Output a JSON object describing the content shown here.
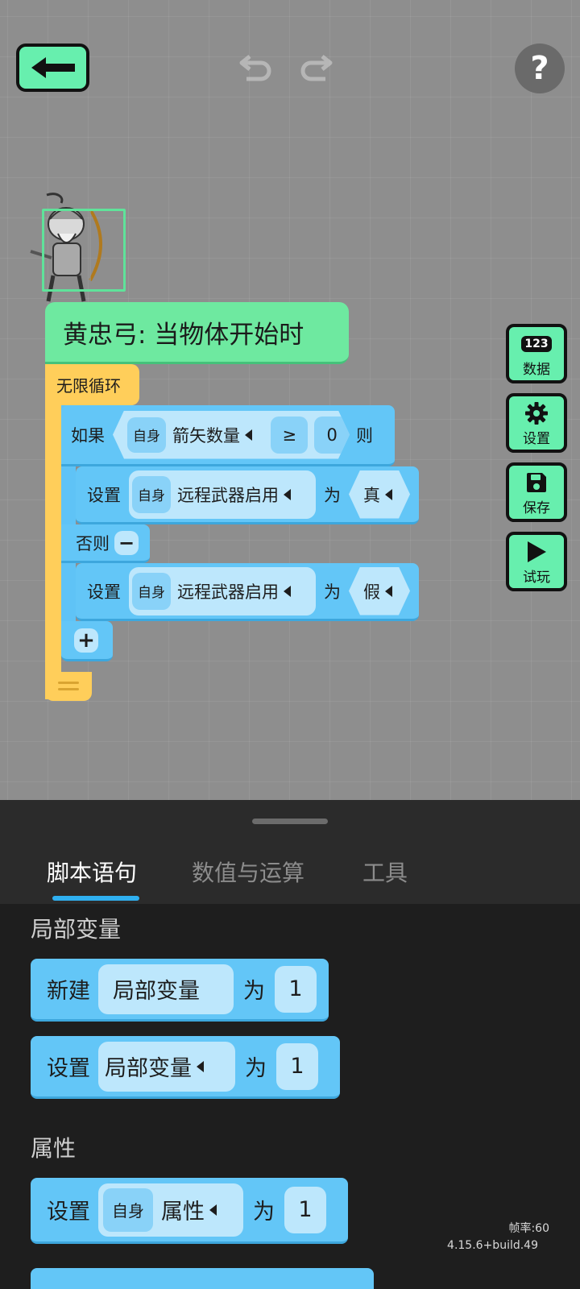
{
  "toolbar": {
    "help_label": "?"
  },
  "hat": {
    "label": "黄忠弓: 当物体开始时"
  },
  "loop": {
    "label": "无限循环"
  },
  "if_block": {
    "if_label": "如果",
    "target": "自身",
    "variable": "箭矢数量",
    "operator": "≥",
    "value": "0",
    "then_label": "则"
  },
  "set_true": {
    "set_label": "设置",
    "target": "自身",
    "property": "远程武器启用",
    "to_label": "为",
    "value": "真"
  },
  "else_block": {
    "label": "否则",
    "minus": "−"
  },
  "set_false": {
    "set_label": "设置",
    "target": "自身",
    "property": "远程武器启用",
    "to_label": "为",
    "value": "假"
  },
  "add_branch": "+",
  "side_buttons": [
    {
      "icon_text": "123",
      "label": "数据"
    },
    {
      "label": "设置"
    },
    {
      "label": "保存"
    },
    {
      "label": "试玩"
    }
  ],
  "tabs": [
    {
      "label": "脚本语句"
    },
    {
      "label": "数值与运算"
    },
    {
      "label": "工具"
    }
  ],
  "palette": {
    "section1": "局部变量",
    "new_var": {
      "new_label": "新建",
      "name": "局部变量",
      "to_label": "为",
      "value": "1"
    },
    "set_var": {
      "set_label": "设置",
      "name": "局部变量",
      "to_label": "为",
      "value": "1"
    },
    "section2": "属性",
    "set_attr": {
      "set_label": "设置",
      "target": "自身",
      "attr": "属性",
      "to_label": "为",
      "value": "1"
    }
  },
  "footer": {
    "fps": "帧率:60",
    "version": "4.15.6+build.49"
  },
  "colors": {
    "green": "#67efae",
    "yellow": "#ffce5a",
    "blue": "#63c6f7"
  }
}
